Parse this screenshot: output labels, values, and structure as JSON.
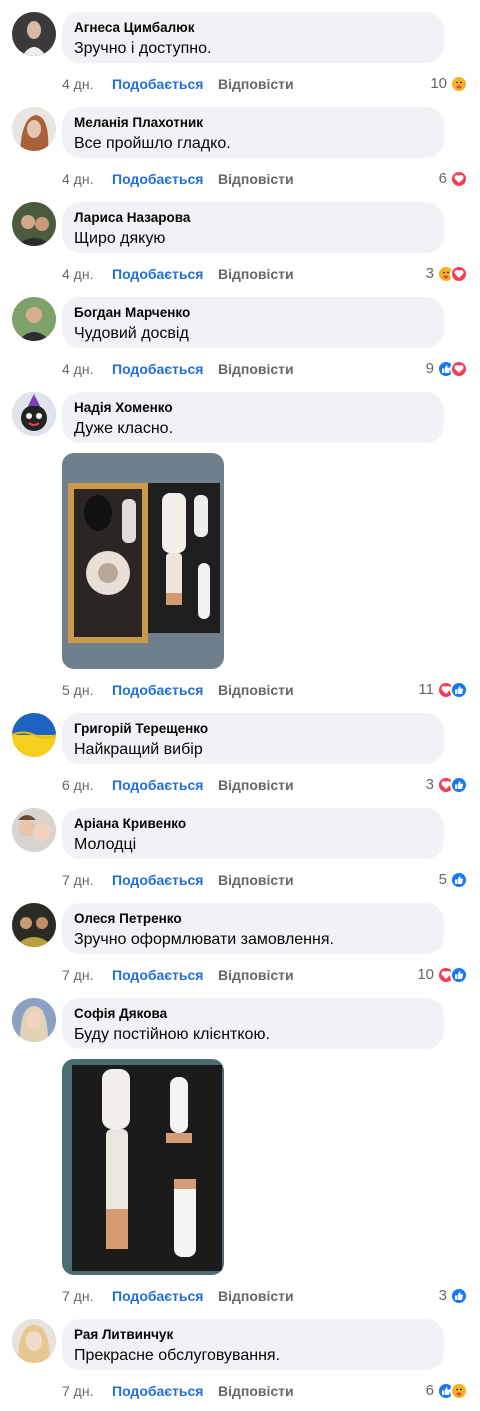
{
  "actions": {
    "like_label": "Подобається",
    "reply_label": "Відповісти"
  },
  "comments": [
    {
      "author": "Агнеса Цимбалюк",
      "text": "Зручно і доступно.",
      "time": "4 дн.",
      "count": "10",
      "reactions": [
        "care"
      ]
    },
    {
      "author": "Меланія Плахотник",
      "text": "Все пройшло гладко.",
      "time": "4 дн.",
      "count": "6",
      "reactions": [
        "love"
      ]
    },
    {
      "author": "Лариса Назарова",
      "text": "Щиро дякую",
      "time": "4 дн.",
      "count": "3",
      "reactions": [
        "care",
        "love"
      ]
    },
    {
      "author": "Богдан Марченко",
      "text": "Чудовий досвід",
      "time": "4 дн.",
      "count": "9",
      "reactions": [
        "like",
        "love"
      ]
    },
    {
      "author": "Надія Хоменко",
      "text": "Дуже класно.",
      "time": "5 дн.",
      "count": "11",
      "reactions": [
        "love",
        "like"
      ],
      "photo": "hair-styler-box-top-view"
    },
    {
      "author": "Григорій Терещенко",
      "text": "Найкращий вибір",
      "time": "6 дн.",
      "count": "3",
      "reactions": [
        "love",
        "like"
      ]
    },
    {
      "author": "Аріана Кривенко",
      "text": "Молодці",
      "time": "7 дн.",
      "count": "5",
      "reactions": [
        "like"
      ]
    },
    {
      "author": "Олеся Петренко",
      "text": "Зручно оформлювати замовлення.",
      "time": "7 дн.",
      "count": "10",
      "reactions": [
        "love",
        "like"
      ]
    },
    {
      "author": "Софія Дякова",
      "text": "Буду постійною клієнткою.",
      "time": "7 дн.",
      "count": "3",
      "reactions": [
        "like"
      ],
      "photo": "hair-styler-closeup"
    },
    {
      "author": "Рая Литвинчук",
      "text": "Прекрасне обслуговування.",
      "time": "7 дн.",
      "count": "6",
      "reactions": [
        "like",
        "care"
      ]
    }
  ],
  "colors": {
    "link_blue": "#216fdb",
    "bubble_bg": "#f0f2f5",
    "meta_gray": "#65676b",
    "like_blue": "#1877f2",
    "love_red": "#f33e58",
    "care_yellow": "#f7b125"
  }
}
